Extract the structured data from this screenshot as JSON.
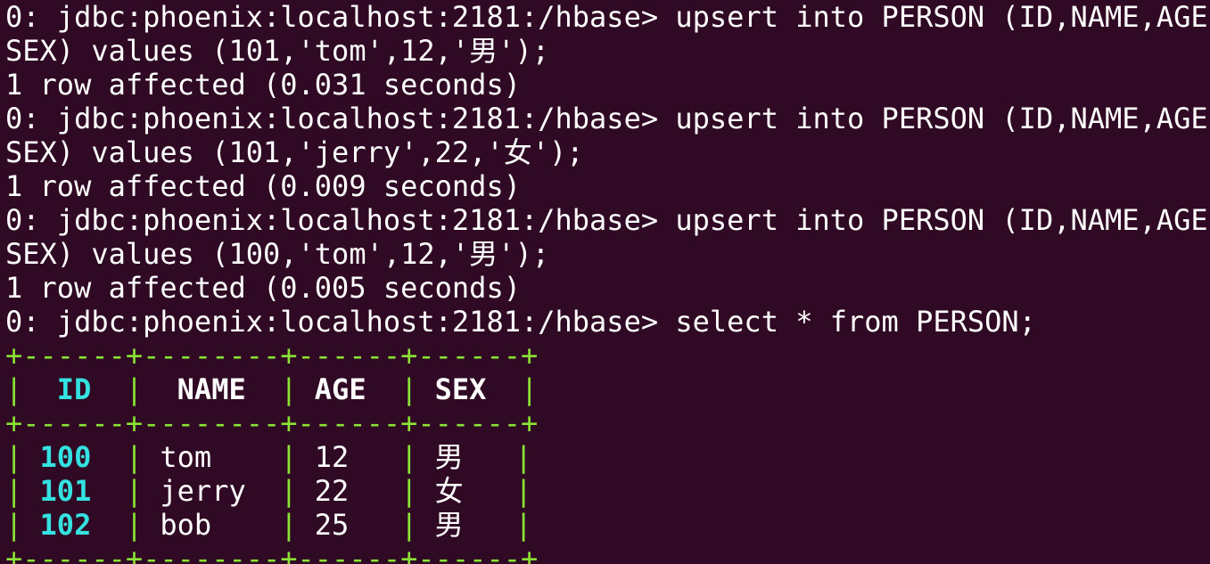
{
  "terminal": {
    "lines": [
      "0: jdbc:phoenix:localhost:2181:/hbase> upsert into PERSON (ID,NAME,AGE,",
      "SEX) values (101,'tom',12,'男');",
      "1 row affected (0.031 seconds)",
      "0: jdbc:phoenix:localhost:2181:/hbase> upsert into PERSON (ID,NAME,AGE,",
      "SEX) values (101,'jerry',22,'女');",
      "1 row affected (0.009 seconds)",
      "0: jdbc:phoenix:localhost:2181:/hbase> upsert into PERSON (ID,NAME,AGE,",
      "SEX) values (100,'tom',12,'男');",
      "1 row affected (0.005 seconds)",
      "0: jdbc:phoenix:localhost:2181:/hbase> select * from PERSON;"
    ]
  },
  "table": {
    "border_line": "+------+--------+------+------+",
    "headers": [
      "ID",
      "NAME",
      "AGE",
      "SEX"
    ],
    "rows": [
      {
        "id": "100",
        "name": "tom",
        "age": "12",
        "sex": "男"
      },
      {
        "id": "101",
        "name": "jerry",
        "age": "22",
        "sex": "女"
      },
      {
        "id": "102",
        "name": "bob",
        "age": "25",
        "sex": "男"
      }
    ],
    "separator": "|"
  },
  "colors": {
    "background": "#300a24",
    "text": "#ffffff",
    "border": "#8ae234",
    "id_column": "#34e2e2"
  }
}
